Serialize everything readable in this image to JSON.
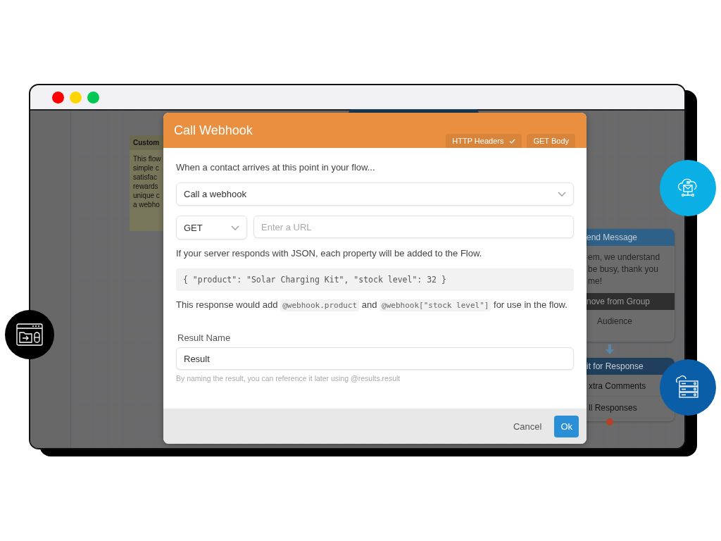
{
  "window": {
    "controls": [
      {
        "color": "#ff0000"
      },
      {
        "color": "#ffd500"
      },
      {
        "color": "#00c853"
      }
    ]
  },
  "background_nodes": {
    "note": {
      "title": "Custom",
      "lines": [
        "This flow",
        "simple c",
        "satisfac",
        "rewards",
        "unique c",
        "a webho"
      ]
    },
    "send_message": {
      "header": "end Message",
      "lines": [
        "em, we understand",
        "be busy, thank you",
        "me!"
      ],
      "action": "nove from Group",
      "action_detail": "Audience"
    },
    "wait": {
      "header": "it for Response",
      "categories": [
        "xtra Comments",
        "ll Responses"
      ]
    }
  },
  "modal": {
    "title": "Call Webhook",
    "tabs": [
      {
        "label": "HTTP Headers",
        "checked": true
      },
      {
        "label": "GET Body",
        "checked": false
      }
    ],
    "intro": "When a contact arrives at this point in your flow...",
    "action_select": {
      "value": "Call a webhook"
    },
    "method_select": {
      "value": "GET"
    },
    "url_field": {
      "placeholder": "Enter a URL"
    },
    "json_note": "If your server responds with JSON, each property will be added to the Flow.",
    "example": "{ \"product\": \"Solar Charging Kit\", \"stock level\": 32 }",
    "response_note": [
      {
        "kind": "text",
        "text": "This response would add"
      },
      {
        "kind": "code",
        "text": "@webhook.product"
      },
      {
        "kind": "text",
        "text": "and"
      },
      {
        "kind": "code",
        "text": "@webhook[\"stock level\"]"
      },
      {
        "kind": "text",
        "text": "for use in the flow."
      }
    ],
    "result_label": "Result Name",
    "result_field": {
      "value": "Result"
    },
    "result_hint": "By naming the result, you can reference it later using @results.result",
    "buttons": [
      {
        "kind": "secondary",
        "label": "Cancel"
      },
      {
        "kind": "primary",
        "label": "Ok"
      }
    ]
  }
}
